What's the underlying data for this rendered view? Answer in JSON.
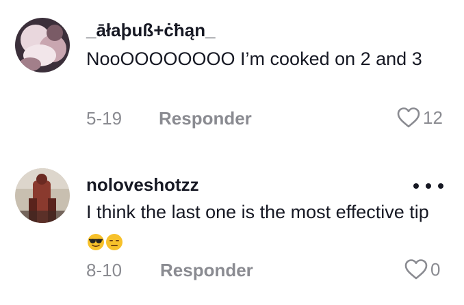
{
  "comments": [
    {
      "username": "_āłaþuß+ċħąn_",
      "text": "NooOOOOOOOO I’m cooked on 2 and 3",
      "date": "5-19",
      "reply_label": "Responder",
      "likes": "12",
      "emoji": []
    },
    {
      "username": "noloveshotzz",
      "text": "I think the last one is the most effective tip",
      "date": "8-10",
      "reply_label": "Responder",
      "likes": "0",
      "emoji": [
        "sunglasses-face-emoji",
        "expressionless-face-emoji"
      ]
    }
  ],
  "icons": {
    "like": "heart-outline-icon",
    "more": "more-options-icon"
  },
  "colors": {
    "text": "#161823",
    "secondary": "#8a8b91"
  }
}
